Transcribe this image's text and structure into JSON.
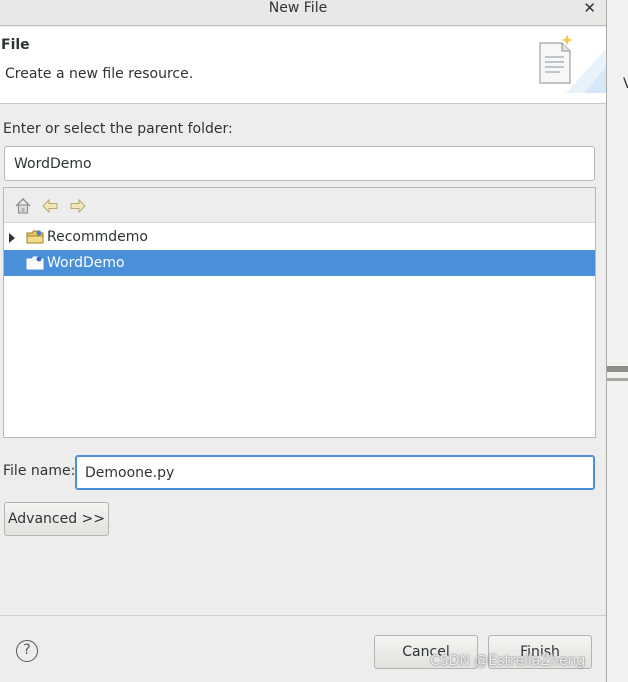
{
  "window": {
    "title": "New File"
  },
  "header": {
    "title": "File",
    "description": "Create a new file resource."
  },
  "parent_folder": {
    "label": "Enter or select the parent folder:",
    "value": "WordDemo"
  },
  "tree": {
    "items": [
      {
        "label": "Recommdemo",
        "expandable": true,
        "selected": false
      },
      {
        "label": "WordDemo",
        "expandable": false,
        "selected": true
      }
    ]
  },
  "file_name": {
    "label": "File name:",
    "value": "Demoone.py"
  },
  "buttons": {
    "advanced": "Advanced >>",
    "cancel": "Cancel",
    "finish": "Finish",
    "help": "?"
  },
  "background": {
    "side_text": "V"
  },
  "watermark": "CSDN @EstrellaZheng",
  "colors": {
    "selection": "#4a90d9",
    "focus_border": "#4a90d9"
  }
}
